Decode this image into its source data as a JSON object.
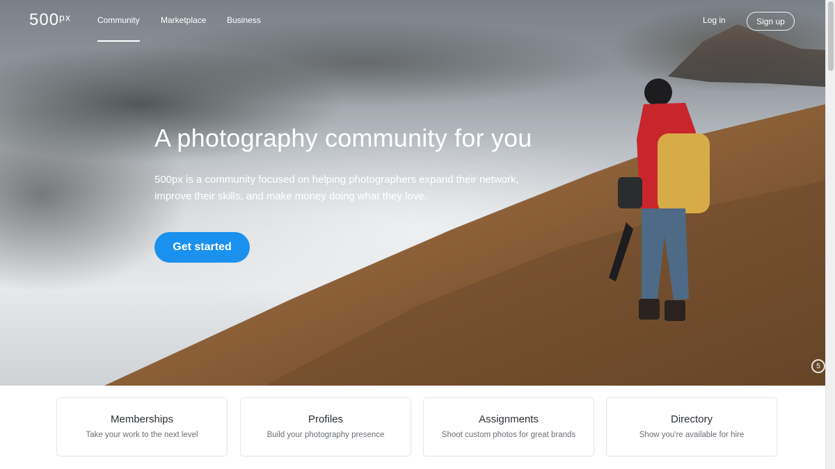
{
  "brand": {
    "logo_main": "500",
    "logo_sup": "px"
  },
  "nav": {
    "links": [
      {
        "label": "Community",
        "active": true
      },
      {
        "label": "Marketplace",
        "active": false
      },
      {
        "label": "Business",
        "active": false
      }
    ],
    "login_label": "Log in",
    "signup_label": "Sign up"
  },
  "hero": {
    "headline": "A photography community for you",
    "subtext": "500px is a community focused on helping photographers expand their network, improve their skills, and make money doing what they love.",
    "cta_label": "Get started",
    "badge_glyph": "5",
    "cta_color": "#1a91ee"
  },
  "cards": [
    {
      "title": "Memberships",
      "desc": "Take your work to the next level"
    },
    {
      "title": "Profiles",
      "desc": "Build your photography presence"
    },
    {
      "title": "Assignments",
      "desc": "Shoot custom photos for great brands"
    },
    {
      "title": "Directory",
      "desc": "Show you're available for hire"
    }
  ]
}
